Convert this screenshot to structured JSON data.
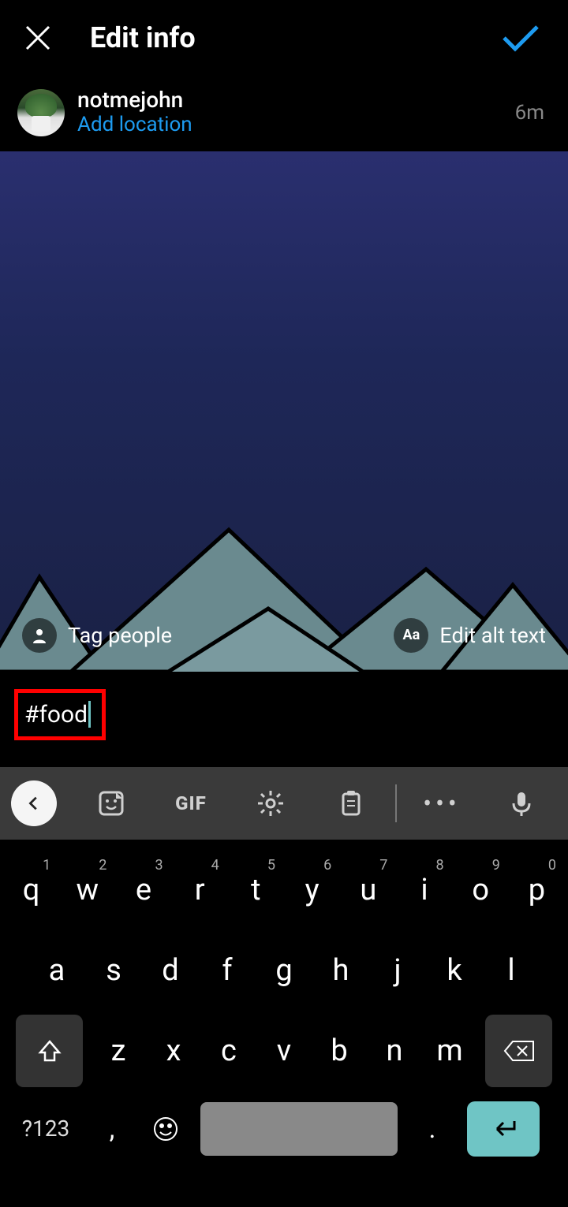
{
  "header": {
    "title": "Edit info"
  },
  "user": {
    "name": "notmejohn",
    "add_location": "Add location",
    "timestamp": "6m"
  },
  "overlay": {
    "tag_people": "Tag people",
    "alt_text": "Edit alt text",
    "alt_icon": "Aa"
  },
  "caption": {
    "text": "#food"
  },
  "keyboard_toolbar": {
    "gif": "GIF",
    "more": "•••"
  },
  "keyboard": {
    "row1": [
      {
        "k": "q",
        "n": "1"
      },
      {
        "k": "w",
        "n": "2"
      },
      {
        "k": "e",
        "n": "3"
      },
      {
        "k": "r",
        "n": "4"
      },
      {
        "k": "t",
        "n": "5"
      },
      {
        "k": "y",
        "n": "6"
      },
      {
        "k": "u",
        "n": "7"
      },
      {
        "k": "i",
        "n": "8"
      },
      {
        "k": "o",
        "n": "9"
      },
      {
        "k": "p",
        "n": "0"
      }
    ],
    "row2": [
      "a",
      "s",
      "d",
      "f",
      "g",
      "h",
      "j",
      "k",
      "l"
    ],
    "row3": [
      "z",
      "x",
      "c",
      "v",
      "b",
      "n",
      "m"
    ],
    "symbols": "?123",
    "comma": ",",
    "period": "."
  }
}
